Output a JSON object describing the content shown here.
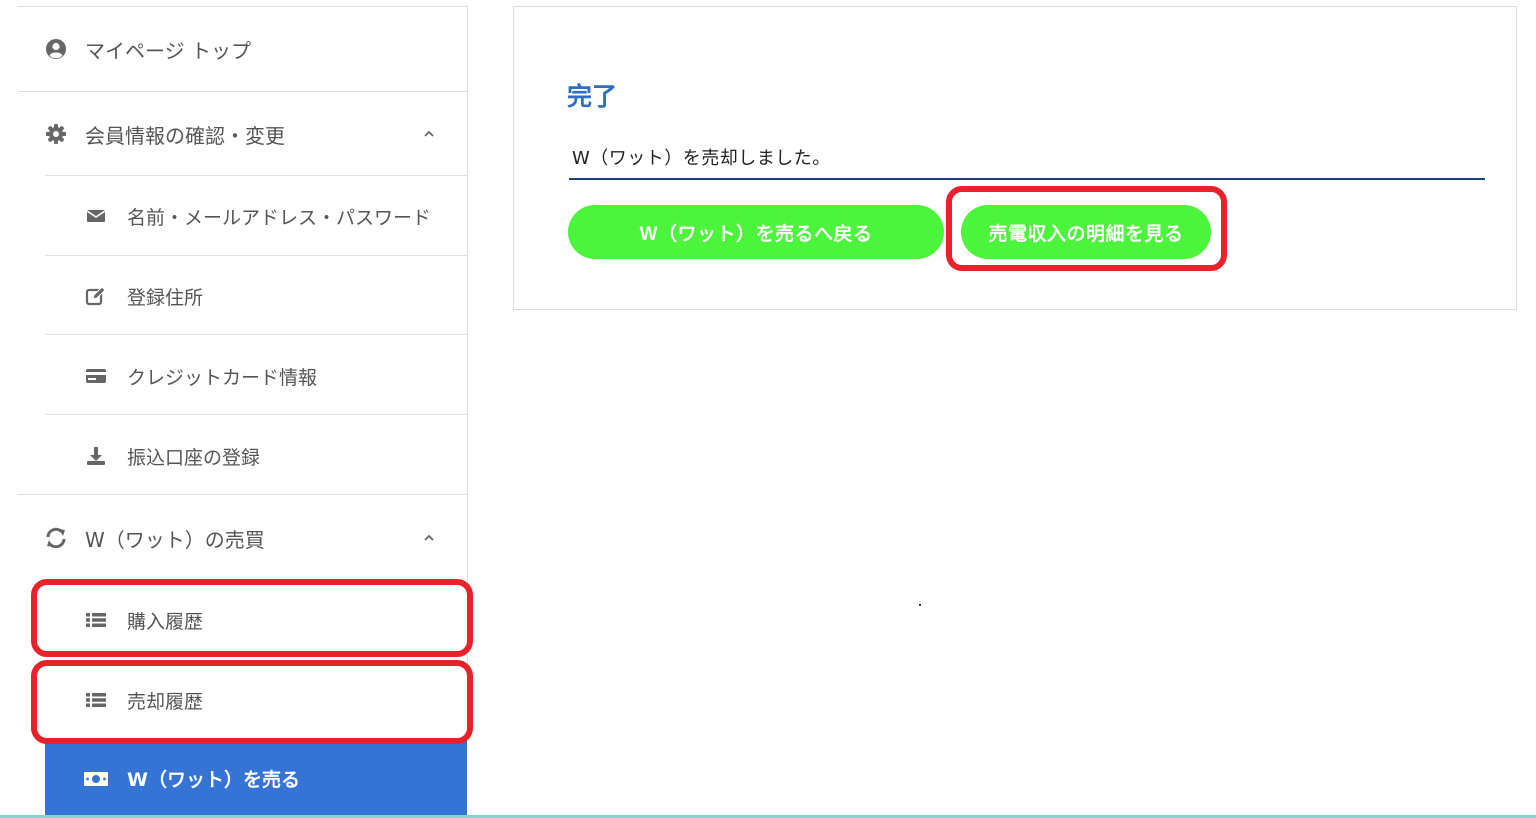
{
  "sidebar": {
    "mypage_top": "マイページ トップ",
    "member_info": "会員情報の確認・変更",
    "name_mail_password": "名前・メールアドレス・パスワード",
    "registered_address": "登録住所",
    "credit_card": "クレジットカード情報",
    "bank_account": "振込口座の登録",
    "watt_trade": "W（ワット）の売買",
    "purchase_history": "購入履歴",
    "sale_history": "売却履歴",
    "sell_watt": "W（ワット）を売る"
  },
  "main": {
    "title": "完了",
    "message": "W（ワット）を売却しました。",
    "back_button": "W（ワット）を売るへ戻る",
    "detail_button": "売電収入の明細を見る"
  },
  "colors": {
    "accent_blue": "#3574d4",
    "button_green": "#4cf43b",
    "highlight_red": "#e8212a",
    "title_blue": "#2f6ec3"
  }
}
